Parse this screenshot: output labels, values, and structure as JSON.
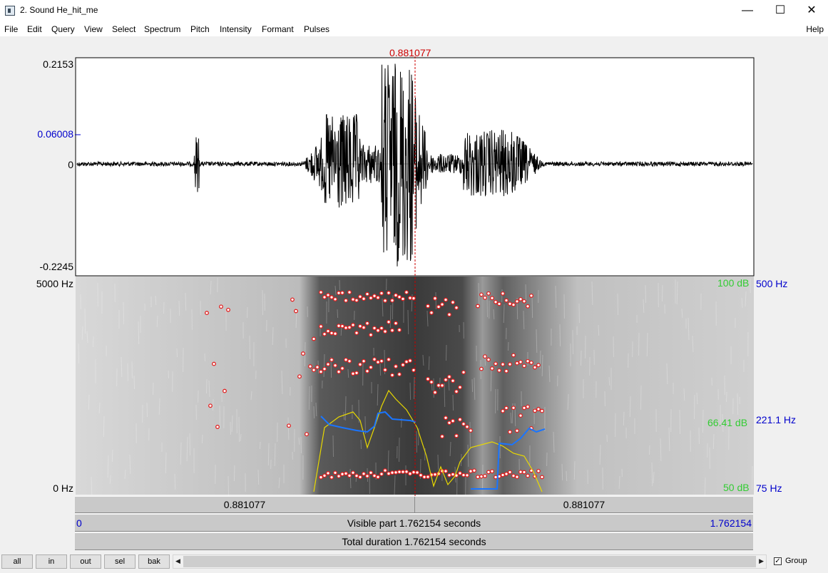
{
  "window": {
    "title": "2. Sound He_hit_me",
    "minimize": "—",
    "maximize": "☐",
    "close": "✕"
  },
  "menu": {
    "items": [
      "File",
      "Edit",
      "Query",
      "View",
      "Select",
      "Spectrum",
      "Pitch",
      "Intensity",
      "Formant",
      "Pulses"
    ],
    "help": "Help"
  },
  "cursor": {
    "time_label": "0.881077",
    "time": 0.881077
  },
  "waveform": {
    "y_top": "0.2153",
    "y_mark": "0.06008",
    "y_zero": "0",
    "y_bottom": "-0.2245"
  },
  "spectrogram": {
    "freq_top": "5000 Hz",
    "freq_bottom": "0 Hz",
    "db_top": "100 dB",
    "db_mid": "66.41 dB",
    "db_bottom": "50 dB",
    "pitch_top": "500 Hz",
    "pitch_mid": "221.1 Hz",
    "pitch_bottom": "75 Hz"
  },
  "time_bars": {
    "left_half": "0.881077",
    "right_half": "0.881077",
    "visible_start": "0",
    "visible_label": "Visible part 1.762154 seconds",
    "visible_end": "1.762154",
    "total_label": "Total duration 1.762154 seconds"
  },
  "buttons": {
    "all": "all",
    "in": "in",
    "out": "out",
    "sel": "sel",
    "bak": "bak"
  },
  "scrollbar": {
    "left_arrow": "◀",
    "right_arrow": "▶"
  },
  "group": {
    "label": "Group",
    "checked": "✓"
  },
  "colors": {
    "cursor": "#cc0000",
    "formant": "#e02020",
    "pitch": "#0066ff",
    "intensity": "#f0e000",
    "db_text": "#33cc33",
    "blue_text": "#0000cc"
  }
}
